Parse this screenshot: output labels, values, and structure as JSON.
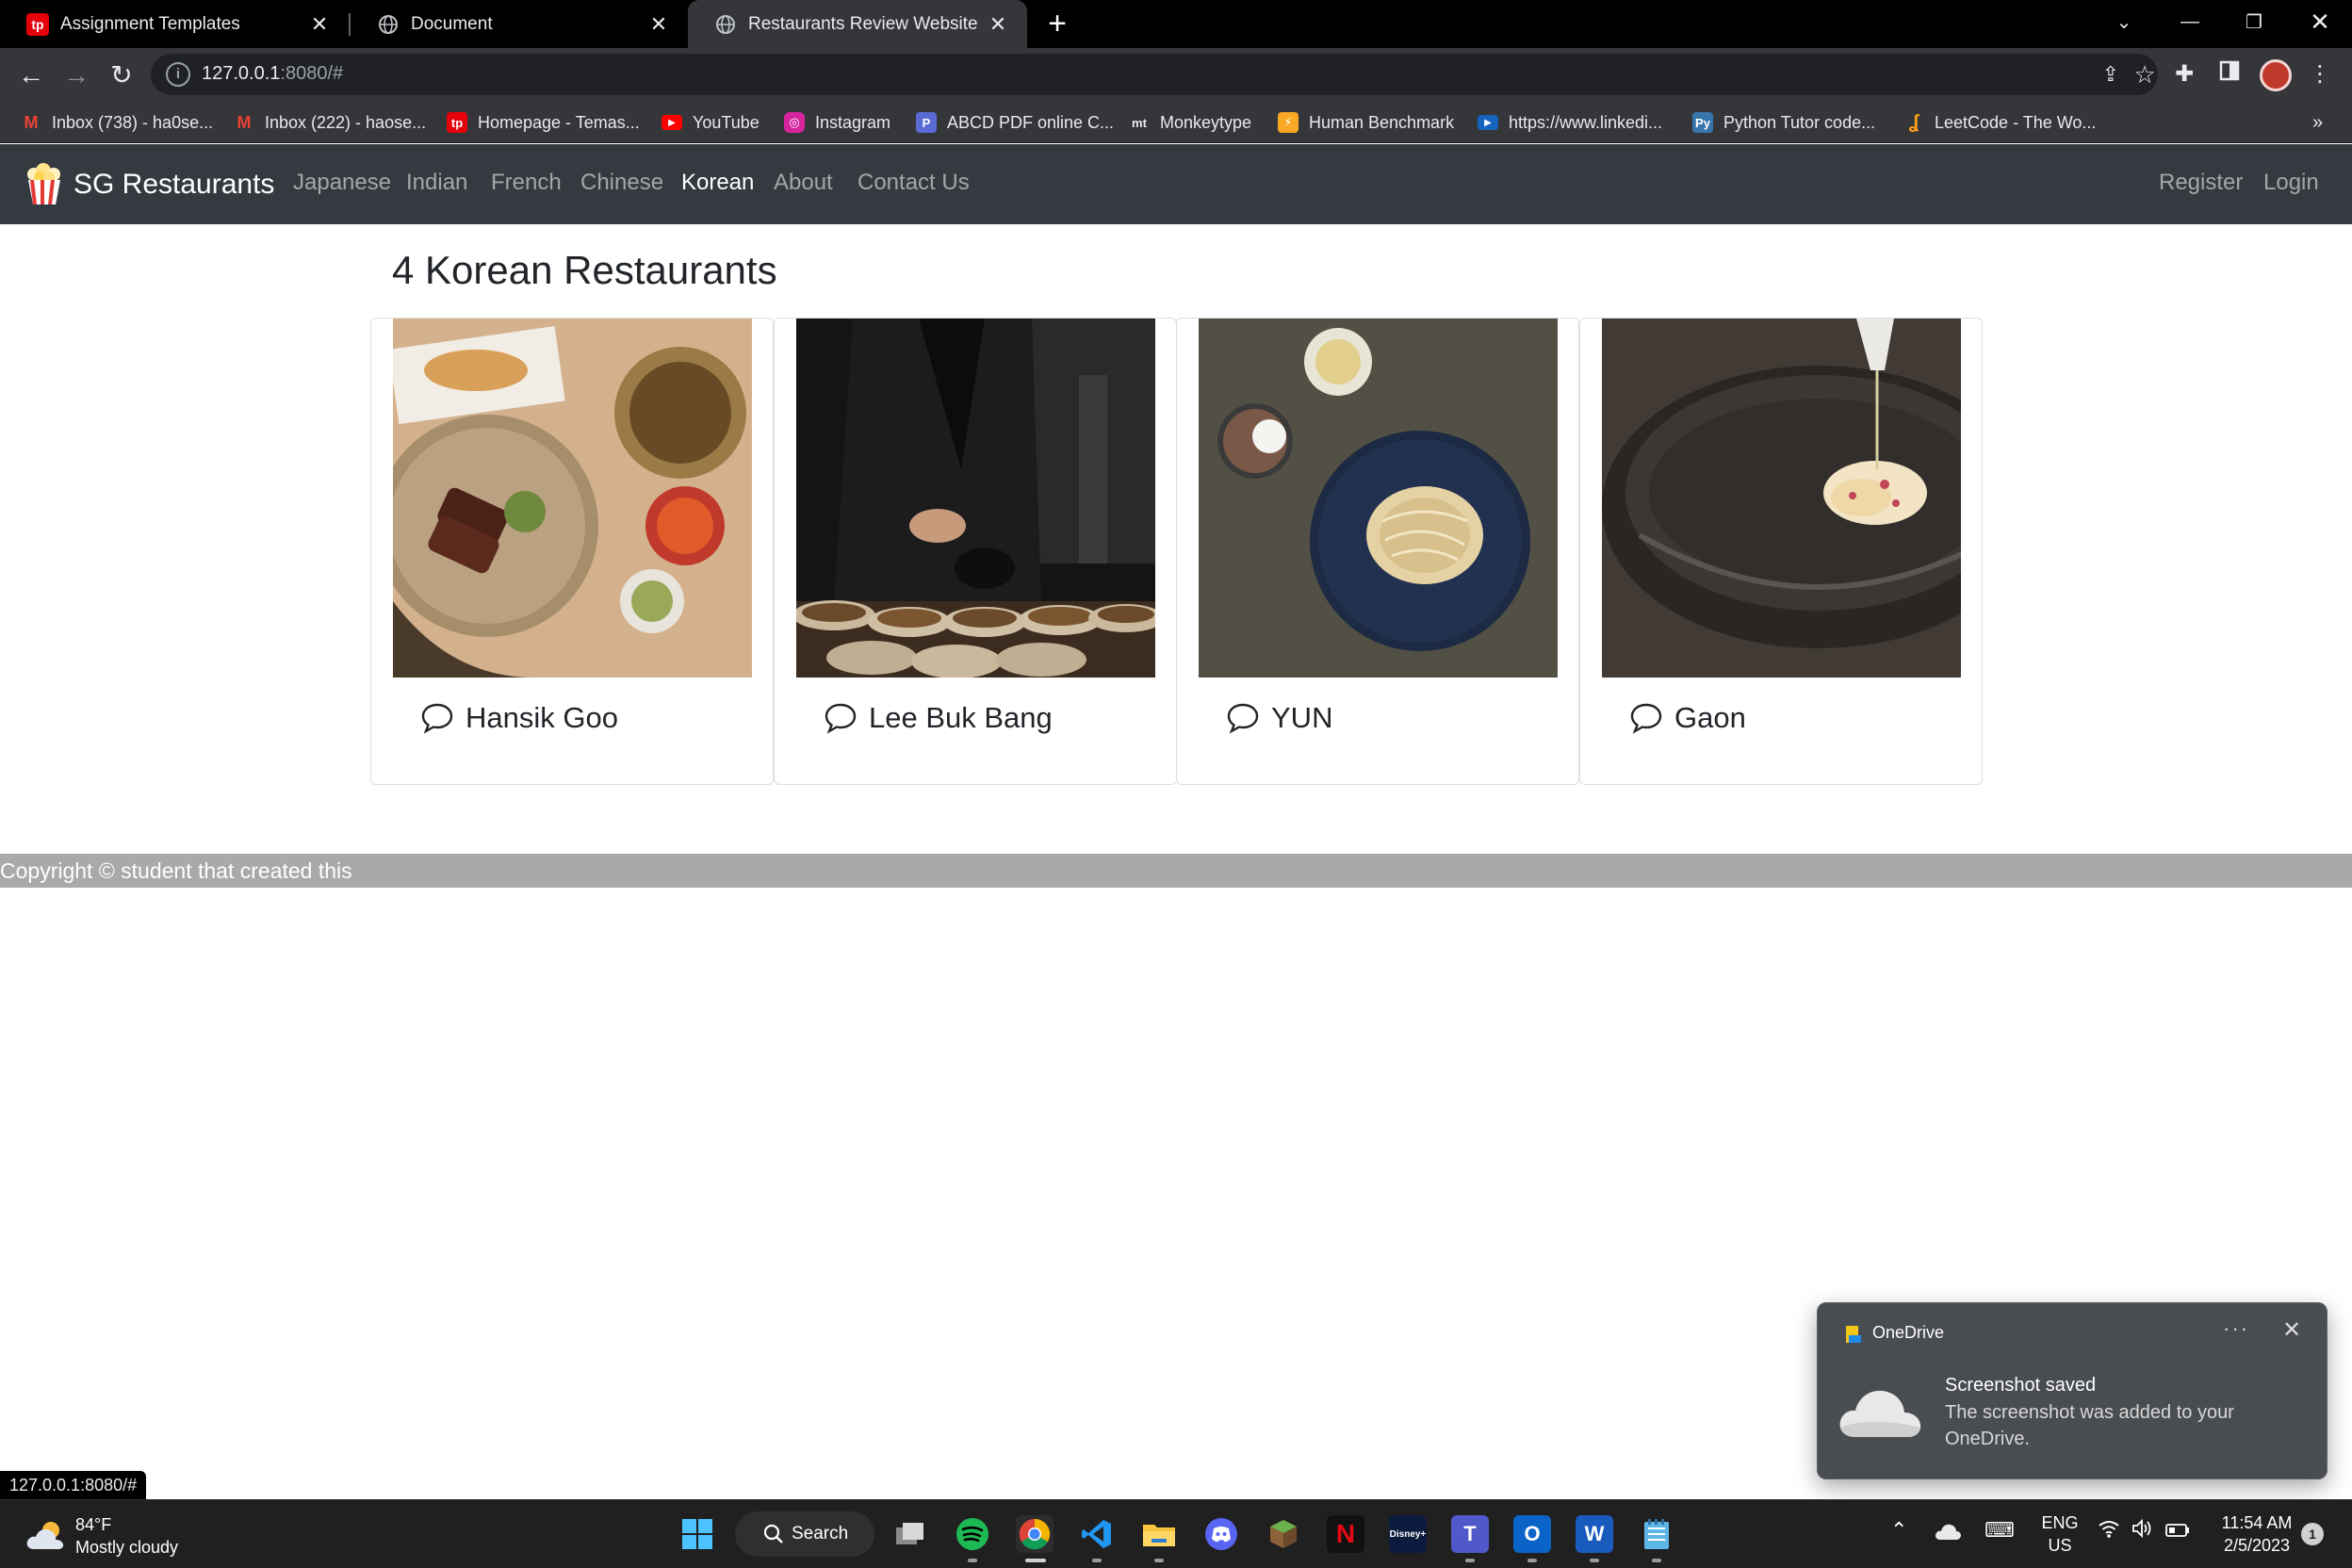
{
  "browser": {
    "tabs": [
      {
        "title": "Assignment Templates",
        "icon": "tp-icon",
        "active": false
      },
      {
        "title": "Document",
        "icon": "globe-icon",
        "active": false
      },
      {
        "title": "Restaurants Review Website",
        "icon": "globe-icon",
        "active": true
      }
    ],
    "url_host": "127.0.0.1",
    "url_rest": ":8080/#",
    "bookmarks": [
      {
        "label": "Inbox (738) - ha0se...",
        "icon": "gmail-icon",
        "color": "#ea4335"
      },
      {
        "label": "Inbox (222) - haose...",
        "icon": "gmail-icon",
        "color": "#ea4335"
      },
      {
        "label": "Homepage - Temas...",
        "icon": "tp-icon",
        "color": "#e5000a"
      },
      {
        "label": "YouTube",
        "icon": "youtube-icon",
        "color": "#ff0000"
      },
      {
        "label": "Instagram",
        "icon": "instagram-icon",
        "color": "#d6249f"
      },
      {
        "label": "ABCD PDF online C...",
        "icon": "pdf-icon",
        "color": "#5b6bd6"
      },
      {
        "label": "Monkeytype",
        "icon": "monkeytype-icon",
        "color": "#323437"
      },
      {
        "label": "Human Benchmark",
        "icon": "bolt-icon",
        "color": "#f9a825"
      },
      {
        "label": "https://www.linkedi...",
        "icon": "video-icon",
        "color": "#1565c0"
      },
      {
        "label": "Python Tutor code...",
        "icon": "python-icon",
        "color": "#3776ab"
      },
      {
        "label": "LeetCode - The Wo...",
        "icon": "leetcode-icon",
        "color": "#ffa116"
      }
    ]
  },
  "site": {
    "brand": "SG Restaurants",
    "nav": [
      "Japanese",
      "Indian",
      "French",
      "Chinese",
      "Korean",
      "About",
      "Contact Us"
    ],
    "active_nav": "Korean",
    "auth": [
      "Register",
      "Login"
    ],
    "page_title": "4 Korean Restaurants",
    "restaurants": [
      {
        "name": "Hansik Goo"
      },
      {
        "name": "Lee Buk Bang"
      },
      {
        "name": "YUN"
      },
      {
        "name": "Gaon"
      }
    ],
    "footer": "Copyright © student that created this"
  },
  "status_bar_url": "127.0.0.1:8080/#",
  "toast": {
    "app": "OneDrive",
    "title": "Screenshot saved",
    "body": "The screenshot was added to your OneDrive."
  },
  "taskbar": {
    "weather_temp": "84°F",
    "weather_desc": "Mostly cloudy",
    "search_label": "Search",
    "lang_top": "ENG",
    "lang_bottom": "US",
    "time": "11:54 AM",
    "date": "2/5/2023",
    "notification_count": "1"
  },
  "colors": {
    "site_nav_bg": "#343a40",
    "footer_bg": "#a9a9a9",
    "browser_frame": "#35363a"
  }
}
